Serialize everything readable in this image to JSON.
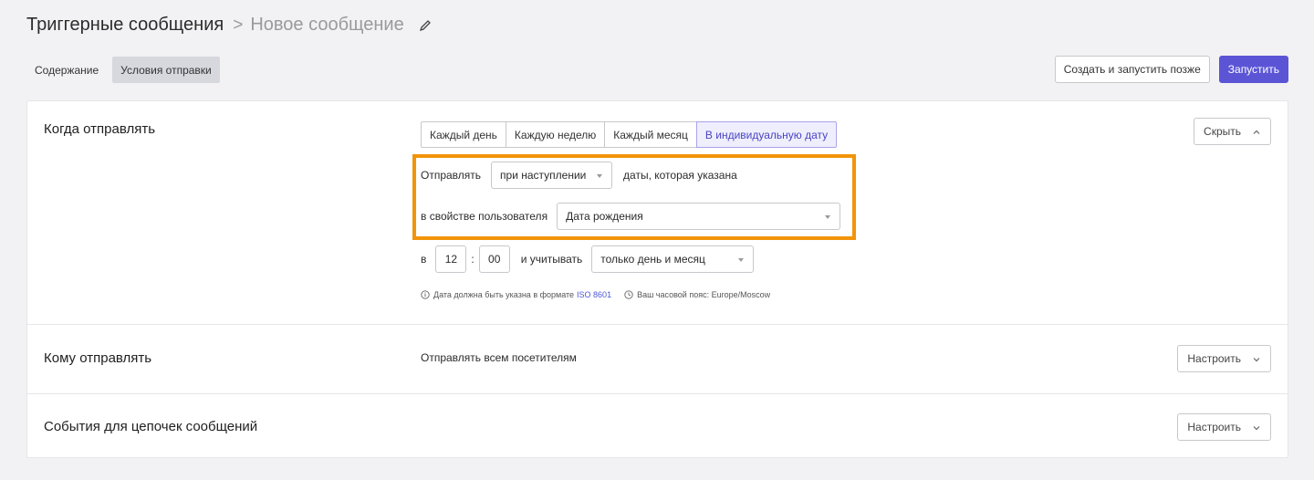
{
  "header": {
    "title": "Триггерные сообщения",
    "separator": ">",
    "subtitle": "Новое сообщение"
  },
  "tabs": [
    {
      "label": "Содержание",
      "active": false
    },
    {
      "label": "Условия отправки",
      "active": true
    }
  ],
  "actions": {
    "create_later": "Создать и запустить позже",
    "launch": "Запустить"
  },
  "when": {
    "title": "Когда отправлять",
    "hide_label": "Скрыть",
    "frequency": [
      "Каждый день",
      "Каждую неделю",
      "Каждый месяц",
      "В индивидуальную дату"
    ],
    "frequency_selected": "В индивидуальную дату",
    "send_label": "Отправлять",
    "send_mode": "при наступлении",
    "date_label": "даты, которая указана",
    "property_label": "в свойстве пользователя",
    "property_value": "Дата рождения",
    "at_label": "в",
    "hour": "12",
    "colon": ":",
    "minute": "00",
    "consider_label": "и учитывать",
    "consider_value": "только день и месяц",
    "hint_format": "Дата должна быть указна в формате",
    "hint_link": "ISO 8601",
    "hint_timezone": "Ваш часовой пояс: Europe/Moscow"
  },
  "who": {
    "title": "Кому отправлять",
    "summary": "Отправлять всем посетителям",
    "configure_label": "Настроить"
  },
  "events": {
    "title": "События для цепочек сообщений",
    "configure_label": "Настроить"
  },
  "colors": {
    "primary": "#5b55d6",
    "highlight": "#f2940a",
    "link": "#4a56d8"
  }
}
